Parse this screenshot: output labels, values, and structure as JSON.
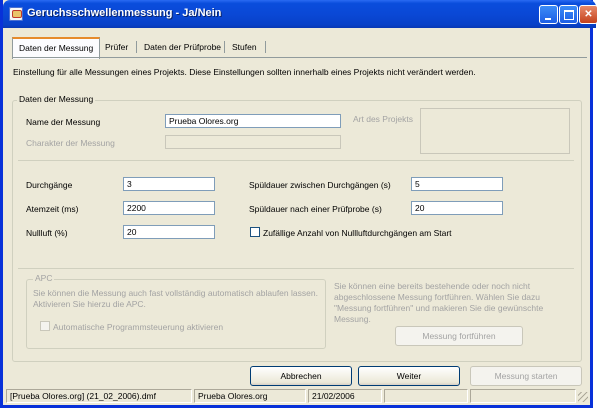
{
  "window": {
    "title": "Geruchsschwellenmessung - Ja/Nein",
    "icon": "app-icon"
  },
  "tabs": [
    {
      "label": "Daten der Messung",
      "active": true
    },
    {
      "label": "Prüfer",
      "active": false
    },
    {
      "label": "Daten der Prüfprobe",
      "active": false
    },
    {
      "label": "Stufen",
      "active": false
    }
  ],
  "intro": "Einstellung für alle Messungen eines Projekts. Diese Einstellungen sollten innerhalb eines Projekts nicht verändert werden.",
  "group_messung": {
    "title": "Daten der Messung",
    "name_label": "Name der Messung",
    "name_value": "Prueba Olores.org",
    "charakter_label": "Charakter der Messung",
    "charakter_value": "",
    "art_label": "Art des Projekts"
  },
  "fields": {
    "durchgaenge_label": "Durchgänge",
    "durchgaenge_value": "3",
    "atemzeit_label": "Atemzeit (ms)",
    "atemzeit_value": "2200",
    "nullluft_label": "Nullluft (%)",
    "nullluft_value": "20",
    "spuel_zwischen_label": "Spüldauer zwischen Durchgängen (s)",
    "spuel_zwischen_value": "5",
    "spuel_nach_label": "Spüldauer nach einer Prüfprobe (s)",
    "spuel_nach_value": "20",
    "zufall_label": "Zufällige Anzahl von Nullluftdurchgängen am Start",
    "zufall_checked": false
  },
  "apc": {
    "title": "APC",
    "text": "Sie können die Messung auch fast vollständig automatisch ablaufen lassen. Aktivieren Sie hierzu die APC.",
    "checkbox_label": "Automatische Programmsteuerung aktivieren",
    "checkbox_checked": false
  },
  "fortsetzen": {
    "text": "Sie können eine bereits bestehende oder noch nicht abgeschlossene Messung fortführen. Wählen Sie dazu \"Messung fortführen\" und makieren Sie die gewünschte Messung.",
    "button": "Messung fortführen"
  },
  "buttons": {
    "cancel": "Abbrechen",
    "next": "Weiter",
    "start": "Messung starten"
  },
  "status": {
    "file": "[Prueba Olores.org] (21_02_2006).dmf",
    "project": "Prueba Olores.org",
    "date": "21/02/2006",
    "empty1": "",
    "empty2": ""
  }
}
